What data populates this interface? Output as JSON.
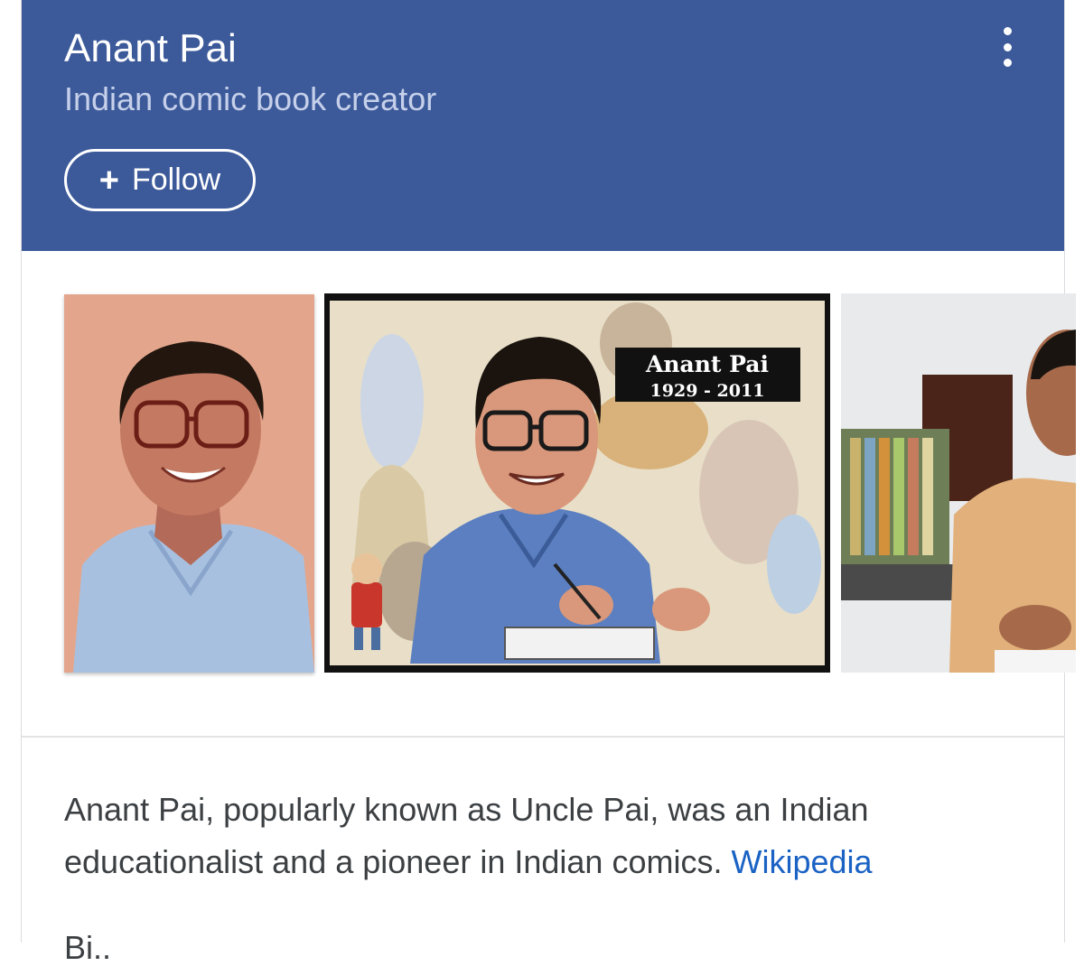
{
  "header": {
    "title": "Anant Pai",
    "subtitle": "Indian comic book creator",
    "follow_plus": "+",
    "follow_label": "Follow"
  },
  "gallery": {
    "images": [
      {
        "alt": "Portrait painting of Anant Pai"
      },
      {
        "alt": "Comic illustration of Anant Pai",
        "caption_name": "Anant Pai",
        "caption_years": "1929 - 2011"
      },
      {
        "alt": "Photo of Anant Pai at his desk"
      }
    ]
  },
  "description": {
    "text": "Anant Pai, popularly known as Uncle Pai, was an Indian educationalist and a pioneer in Indian comics.",
    "source_link": "Wikipedia"
  },
  "next_section_partial": "Bi..",
  "colors": {
    "header_bg": "#3c5a9a",
    "link": "#1a62c4"
  }
}
